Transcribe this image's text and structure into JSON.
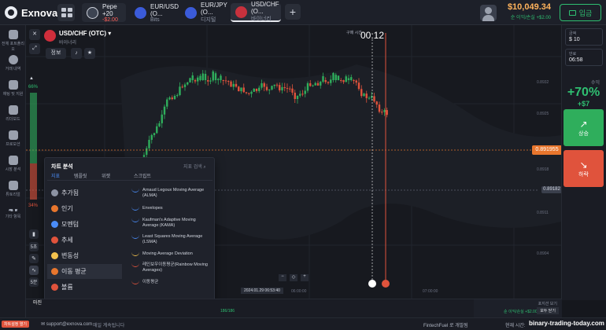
{
  "app": {
    "name": "Exnova"
  },
  "tabs": [
    {
      "label": "Pepe +20",
      "sub": "-$2.00"
    },
    {
      "label": "EUR/USD (O...",
      "sub": "Bits"
    },
    {
      "label": "EUR/JPY (O...",
      "sub": "디지털"
    },
    {
      "label": "USD/CHF (O...",
      "sub": "바이너리"
    }
  ],
  "balance": {
    "amount": "$10,049.34",
    "pl": "순 이익/손실 +$2.00"
  },
  "deposit_label": "입금",
  "sidebar": {
    "items": [
      {
        "label": "전체 포트폴리오"
      },
      {
        "label": "거래 내역"
      },
      {
        "label": "채팅 및 지원"
      },
      {
        "label": "리더보드"
      },
      {
        "label": "프로모션"
      },
      {
        "label": "시장 분석"
      },
      {
        "label": "튜토리얼"
      },
      {
        "label": "기타 항목"
      }
    ]
  },
  "chart_header": {
    "asset": "USD/CHF (OTC)",
    "asset_sub": "바이너리",
    "info_label": "정보",
    "timer_label": "구매 시간",
    "timer": "00:12"
  },
  "price": {
    "current": "0.891955",
    "secondary": "0.89182"
  },
  "price_axis": [
    "0.8932",
    "0.8925",
    "0.8918",
    "0.8911",
    "0.8904"
  ],
  "time_axis": [
    "06:00:00",
    "07:00:00"
  ],
  "timestamp_label": "2024.01.29 06:53:40",
  "sentiment": {
    "up": "66%",
    "down": "34%"
  },
  "time_buttons": [
    "5초",
    "5분"
  ],
  "right_panel": {
    "amount_label": "금액",
    "amount_value": "$ 10",
    "time_label": "만료",
    "time_value": "06:58",
    "payout_label": "수익",
    "payout_pct": "+70%",
    "profit": "+$7",
    "up_label": "상승",
    "down_label": "하락"
  },
  "indicator_menu": {
    "title": "차트 분석",
    "search_placeholder": "지표 검색",
    "tabs": [
      "지표",
      "템플릿",
      "위젯",
      "스크립트"
    ],
    "categories": [
      "추가됨",
      "인기",
      "모멘텀",
      "추세",
      "변동성",
      "이동 평균",
      "볼륨",
      "기타"
    ],
    "items": [
      "Arnaud Legoux Moving Average (ALMA)",
      "Envelopes",
      "Kaufman's Adaptive Moving Average (KAMA)",
      "Least Squares Moving Average (LSMA)",
      "Moving Average Deviation",
      "레인보우이동평균(Rainbow Moving Averages)",
      "이동평균"
    ]
  },
  "bottom": {
    "support_email": "support@exnova.com",
    "more_label": "매일 계속됩니다",
    "live_label": "차트설정 열기",
    "session_label": "FintechFuel 로 개발됨",
    "time_label": "현재 시간:",
    "closed_label": "마진",
    "positions_label": "포지션 보기",
    "close_all_label": "모두 닫기",
    "pl_label": "순 이익/손실 +$2.00",
    "counter": "186/186",
    "watermark": "binary-trading-today.com"
  },
  "colors": {
    "up": "#2fae5c",
    "down": "#e0533c",
    "accent": "#e8762d",
    "profit": "#2fbf71"
  }
}
